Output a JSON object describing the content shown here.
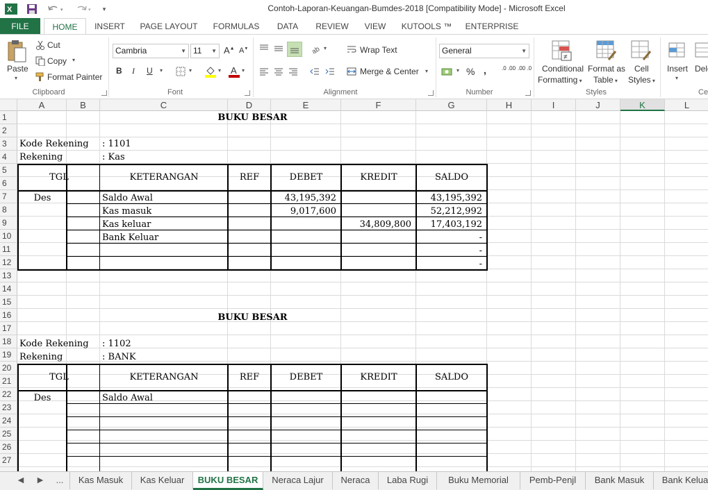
{
  "window": {
    "title": "Contoh-Laporan-Keuangan-Bumdes-2018  [Compatibility Mode] - Microsoft Excel",
    "app_icon": "excel-icon"
  },
  "quick_access": {
    "save_icon": "save-icon",
    "undo_icon": "undo-icon",
    "redo_icon": "redo-icon",
    "customize_icon": "customize-qat-icon"
  },
  "ribbon_tabs": [
    "FILE",
    "HOME",
    "INSERT",
    "PAGE LAYOUT",
    "FORMULAS",
    "DATA",
    "REVIEW",
    "VIEW",
    "KUTOOLS ™",
    "ENTERPRISE"
  ],
  "active_ribbon_tab": "HOME",
  "clipboard": {
    "paste": "Paste",
    "cut": "Cut",
    "copy": "Copy",
    "format_painter": "Format Painter",
    "group": "Clipboard"
  },
  "font": {
    "name": "Cambria",
    "size": "11",
    "group": "Font",
    "bold": "B",
    "italic": "I",
    "underline": "U",
    "grow": "A",
    "shrink": "A",
    "fill_color": "#ffff00",
    "font_color": "#c00000"
  },
  "alignment": {
    "wrap_text": "Wrap Text",
    "merge_center": "Merge & Center",
    "group": "Alignment"
  },
  "number": {
    "format": "General",
    "percent": "%",
    "comma": ",",
    "inc_decimal": ".0 .00",
    "dec_decimal": ".00 .0",
    "group": "Number"
  },
  "styles": {
    "conditional_1": "Conditional",
    "conditional_2": "Formatting",
    "format_table_1": "Format as",
    "format_table_2": "Table",
    "cell_styles_1": "Cell",
    "cell_styles_2": "Styles",
    "group": "Styles"
  },
  "cells_group": {
    "insert": "Insert",
    "delete": "Dele",
    "group": "Ce"
  },
  "columns": [
    "A",
    "B",
    "C",
    "D",
    "E",
    "F",
    "G",
    "H",
    "I",
    "J",
    "K",
    "L"
  ],
  "selected_column": "K",
  "rows": [
    "1",
    "2",
    "3",
    "4",
    "5",
    "6",
    "7",
    "8",
    "9",
    "10",
    "11",
    "12",
    "13",
    "14",
    "15",
    "16",
    "17",
    "18",
    "19",
    "20",
    "21",
    "22",
    "23",
    "24",
    "25",
    "26",
    "27"
  ],
  "sheet": {
    "section1": {
      "title": "BUKU BESAR",
      "kode_label": "Kode Rekening",
      "kode_value": ": 1101",
      "rek_label": "Rekening",
      "rek_value": ":  Kas",
      "headers": {
        "tgl": "TGL",
        "ket": "KETERANGAN",
        "ref": "REF",
        "debet": "DEBET",
        "kredit": "KREDIT",
        "saldo": "SALDO"
      },
      "month": "Des",
      "rows": [
        {
          "ket": "Saldo Awal",
          "debet": "43,195,392",
          "kredit": "",
          "saldo": "43,195,392"
        },
        {
          "ket": "Kas masuk",
          "debet": "9,017,600",
          "kredit": "",
          "saldo": "52,212,992"
        },
        {
          "ket": "Kas keluar",
          "debet": "",
          "kredit": "34,809,800",
          "saldo": "17,403,192"
        },
        {
          "ket": "Bank Keluar",
          "debet": "",
          "kredit": "",
          "saldo": "-"
        },
        {
          "ket": "",
          "debet": "",
          "kredit": "",
          "saldo": "-"
        },
        {
          "ket": "",
          "debet": "",
          "kredit": "",
          "saldo": "-"
        }
      ]
    },
    "section2": {
      "title": "BUKU BESAR",
      "kode_label": "Kode Rekening",
      "kode_value": ": 1102",
      "rek_label": "Rekening",
      "rek_value": ": BANK",
      "headers": {
        "tgl": "TGL",
        "ket": "KETERANGAN",
        "ref": "REF",
        "debet": "DEBET",
        "kredit": "KREDIT",
        "saldo": "SALDO"
      },
      "month": "Des",
      "first_row_ket": "Saldo Awal"
    }
  },
  "sheet_nav": {
    "prev": "◀",
    "next": "▶",
    "more": "..."
  },
  "sheet_tabs": [
    "Kas Masuk",
    "Kas Keluar",
    "BUKU BESAR",
    "Neraca Lajur",
    "Neraca",
    "Laba Rugi",
    "Buku Memorial",
    "Pemb-Penjl",
    "Bank Masuk",
    "Bank Kelua"
  ],
  "active_sheet": "BUKU BESAR"
}
